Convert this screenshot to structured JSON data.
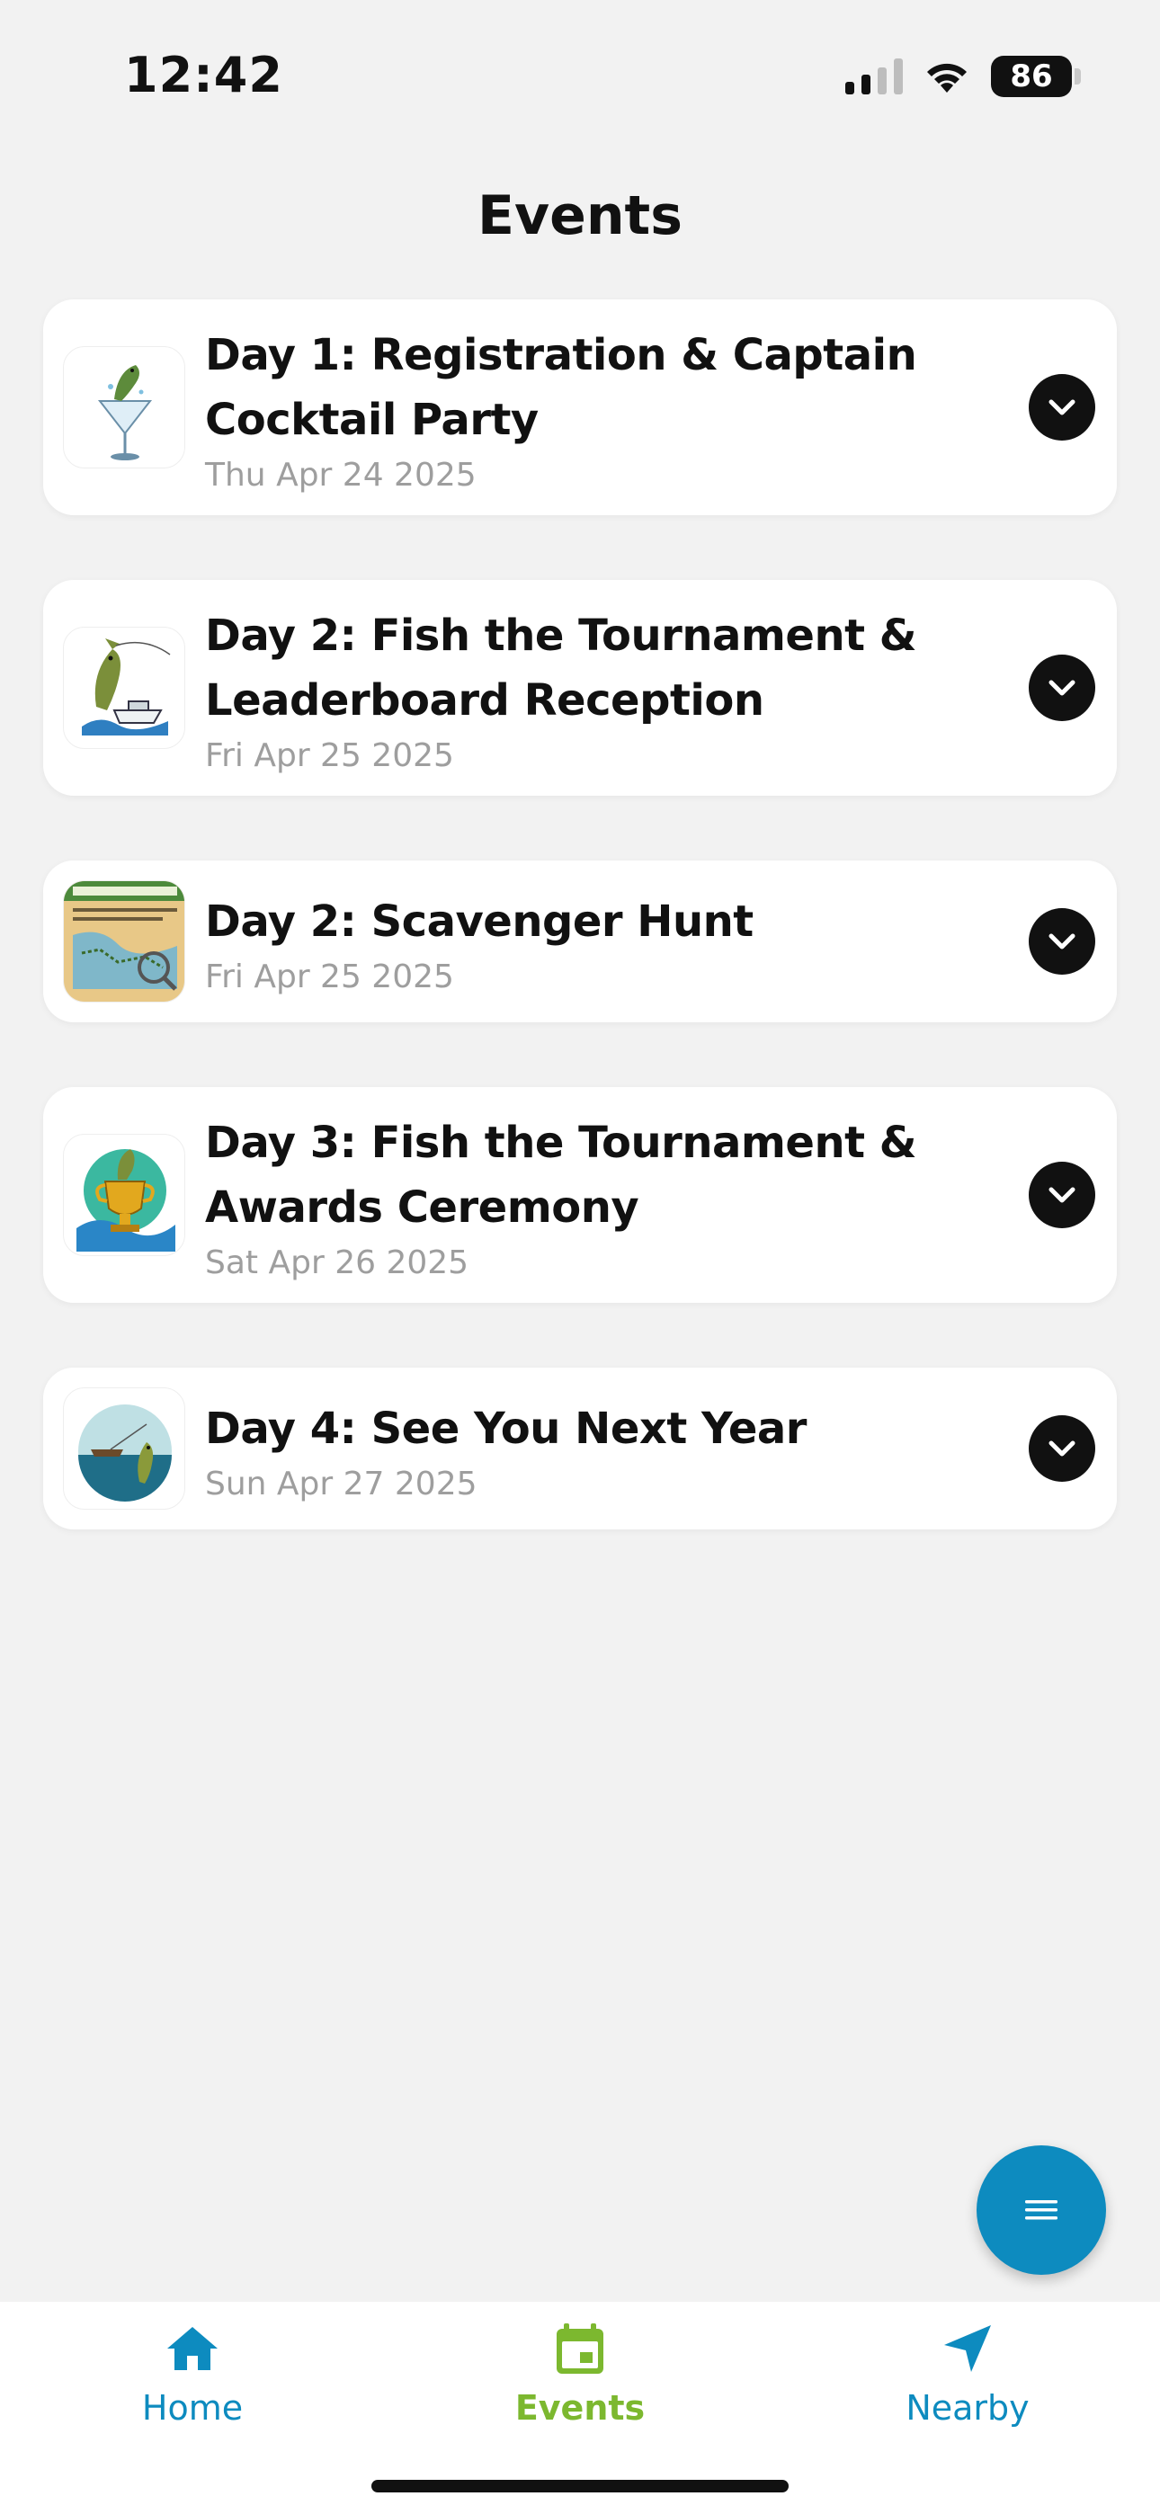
{
  "status_bar": {
    "time": "12:42",
    "battery": "86"
  },
  "header": {
    "title": "Events"
  },
  "events": [
    {
      "title": "Day 1: Registration & Captain Cocktail Party",
      "date": "Thu Apr 24 2025",
      "icon": "fish-cocktail-glass-icon"
    },
    {
      "title": "Day 2: Fish the Tournament & Leaderboard Reception",
      "date": "Fri Apr 25 2025",
      "icon": "fish-boat-icon"
    },
    {
      "title": "Day 2: Scavenger Hunt",
      "date": "Fri Apr 25 2025",
      "icon": "scavenger-map-icon"
    },
    {
      "title": "Day 3: Fish the Tournament & Awards Ceremony",
      "date": "Sat Apr 26 2025",
      "icon": "fish-trophy-icon"
    },
    {
      "title": "Day 4: See You Next Year",
      "date": "Sun Apr 27 2025",
      "icon": "fish-boat-scene-icon"
    }
  ],
  "fab": {
    "icon": "menu-icon"
  },
  "bottom_nav": {
    "items": [
      {
        "label": "Home",
        "icon": "home-icon",
        "active": false
      },
      {
        "label": "Events",
        "icon": "calendar-icon",
        "active": true
      },
      {
        "label": "Nearby",
        "icon": "navigation-arrow-icon",
        "active": false
      }
    ]
  },
  "colors": {
    "accent_blue": "#0d8bbf",
    "active_green": "#7cb82f",
    "background": "#f2f2f2",
    "date_gray": "#9e9e9e"
  }
}
